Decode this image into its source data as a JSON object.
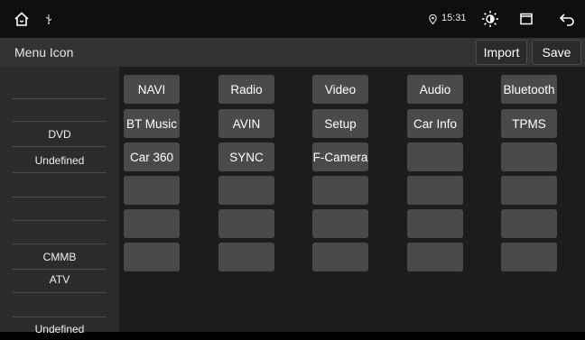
{
  "status_bar": {
    "icons": [
      "home-icon",
      "usb-icon",
      "location-icon",
      "brightness-icon",
      "window-icon",
      "back-icon"
    ],
    "time": "15:31"
  },
  "header": {
    "title": "Menu Icon",
    "import_label": "Import",
    "save_label": "Save"
  },
  "left_list": {
    "items": [
      "",
      "DVD",
      "Undefined",
      "",
      "",
      "CMMB",
      "ATV",
      "",
      "Undefined"
    ]
  },
  "grid": {
    "rows": [
      [
        "NAVI",
        "Radio",
        "Video",
        "Audio",
        "Bluetooth"
      ],
      [
        "BT Music",
        "AVIN",
        "Setup",
        "Car Info",
        "TPMS"
      ],
      [
        "Car 360",
        "SYNC",
        "F-Camera",
        "",
        ""
      ],
      [
        "",
        "",
        "",
        "",
        ""
      ],
      [
        "",
        "",
        "",
        "",
        ""
      ],
      [
        "",
        "",
        "",
        "",
        ""
      ]
    ]
  },
  "colors": {
    "status_bar_bg": "#0f0f0f",
    "title_bar_bg": "#333333",
    "left_panel_bg": "#2c2c2c",
    "grid_bg": "#1d1d1d",
    "tile_bg": "#4a4a4a"
  }
}
